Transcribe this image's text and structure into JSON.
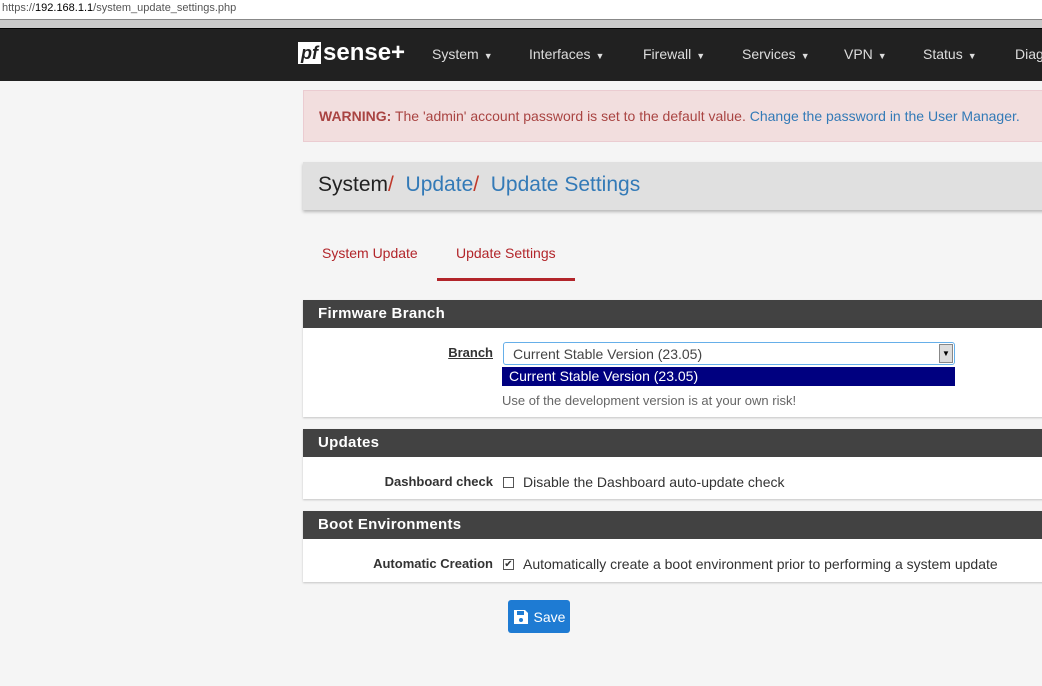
{
  "browser": {
    "url_prefix": "https://",
    "url_host": "192.168.1.1",
    "url_path": "/system_update_settings.php"
  },
  "nav": {
    "logo": "pfsense+",
    "logo_pf": "pf",
    "logo_rest": "sense+",
    "items": [
      "System",
      "Interfaces",
      "Firewall",
      "Services",
      "VPN",
      "Status",
      "Diag"
    ]
  },
  "warning": {
    "label": "WARNING:",
    "text": " The 'admin' account password is set to the default value. ",
    "link": "Change the password in the User Manager."
  },
  "breadcrumb": {
    "root": "System",
    "sep": "/",
    "items": [
      "Update",
      "Update Settings"
    ]
  },
  "tabs": [
    {
      "label": "System Update",
      "active": false
    },
    {
      "label": "Update Settings",
      "active": true
    }
  ],
  "firmware": {
    "title": "Firmware Branch",
    "branch_label": "Branch",
    "branch_value": "Current Stable Version (23.05)",
    "dropdown_options": [
      "Current Stable Version (23.05)"
    ],
    "help": "Use of the development version is at your own risk!"
  },
  "updates": {
    "title": "Updates",
    "dashboard_label": "Dashboard check",
    "dashboard_text": "Disable the Dashboard auto-update check",
    "dashboard_checked": false
  },
  "boot": {
    "title": "Boot Environments",
    "auto_label": "Automatic Creation",
    "auto_text": "Automatically create a boot environment prior to performing a system update",
    "auto_checked": true
  },
  "save_label": "Save",
  "colors": {
    "accent": "#b2252a",
    "link": "#337ab7",
    "nav_bg": "#212121",
    "panel_head": "#424242",
    "save": "#1e7bd3"
  }
}
